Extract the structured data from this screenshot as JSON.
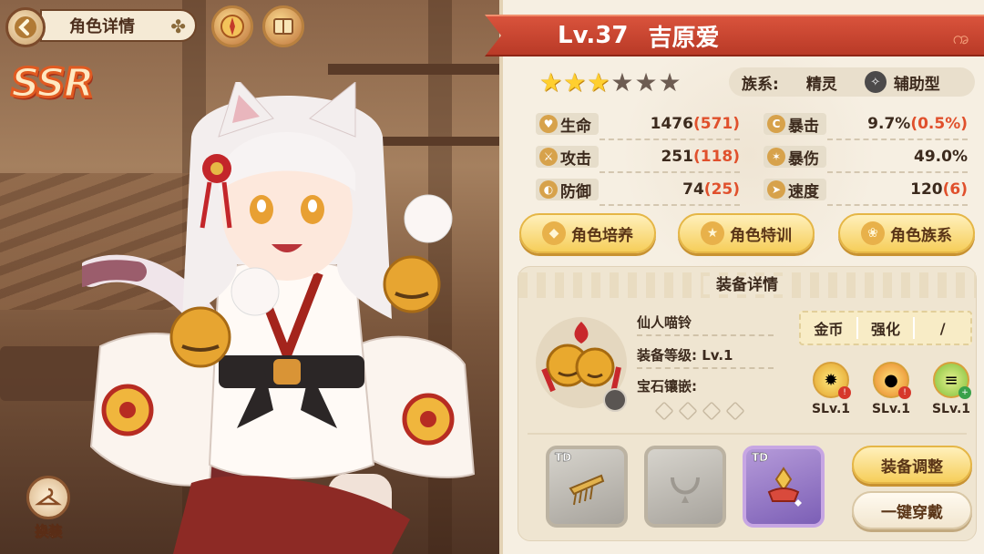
{
  "header": {
    "title": "角色详情"
  },
  "character": {
    "rarity": "SSR",
    "level": "Lv.37",
    "name": "吉原爱",
    "stars_total": 6,
    "stars_filled": 3,
    "tribe_label": "族系:",
    "tribe_value": "精灵",
    "type_value": "辅助型"
  },
  "stats": {
    "hp": {
      "label": "生命",
      "value": "1476",
      "bonus": "(571)"
    },
    "atk": {
      "label": "攻击",
      "value": "251",
      "bonus": "(118)"
    },
    "def": {
      "label": "防御",
      "value": "74",
      "bonus": "(25)"
    },
    "crit": {
      "label": "暴击",
      "value": "9.7%",
      "bonus": "(0.5%)"
    },
    "crit_dmg": {
      "label": "暴伤",
      "value": "49.0%",
      "bonus": ""
    },
    "speed": {
      "label": "速度",
      "value": "120",
      "bonus": "(6)"
    }
  },
  "actions": {
    "train": "角色培养",
    "special": "角色特训",
    "tribe": "角色族系"
  },
  "equipment": {
    "section_title": "装备详情",
    "item_name": "仙人喵铃",
    "item_level": "装备等级: Lv.1",
    "gem_label": "宝石镶嵌:",
    "cost": {
      "gold": "金币",
      "enhance": "强化",
      "value": "/"
    },
    "skills": [
      {
        "level": "SLv.1"
      },
      {
        "level": "SLv.1"
      },
      {
        "level": "SLv.1"
      }
    ],
    "slots": [
      {
        "tag": "TD"
      },
      {
        "tag": ""
      },
      {
        "tag": "TD"
      }
    ],
    "adjust_label": "装备调整",
    "one_click_label": "一键穿戴"
  },
  "swap": {
    "label": "换装"
  },
  "colors": {
    "ribbon": "#c5412d",
    "accent_gold": "#f6ce5a",
    "bonus": "#e0502c"
  }
}
